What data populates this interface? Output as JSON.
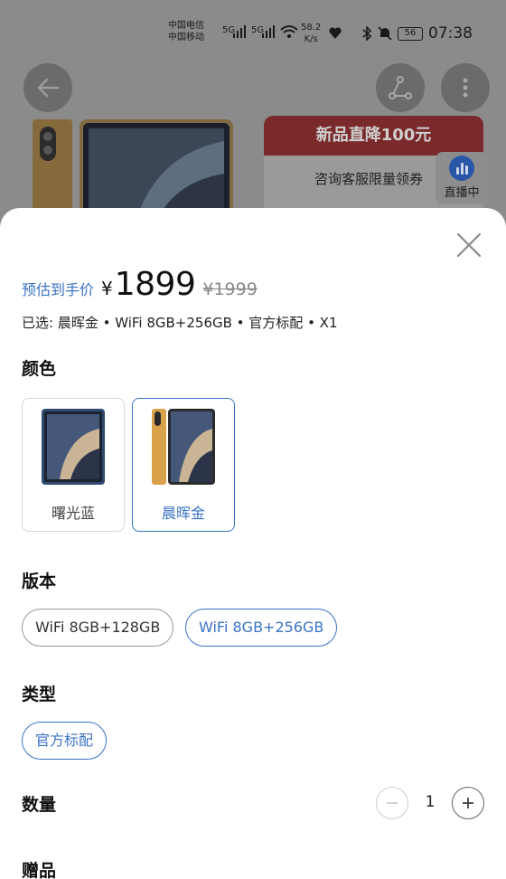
{
  "status_bar": {
    "carrier1": "中国电信",
    "carrier2": "中国移动",
    "net1": "5G",
    "net2": "5G",
    "speed_value": "58.2",
    "speed_unit": "K/s",
    "battery": "56",
    "time": "07:38"
  },
  "background": {
    "promo_banner": "新品直降100元",
    "promo_sub": "咨询客服限量领券",
    "live_label": "直播中"
  },
  "sheet": {
    "price_label": "预估到手价",
    "currency": "¥",
    "price": "1899",
    "original_price": "¥1999",
    "selected_summary": "已选: 晨晖金 • WiFi 8GB+256GB • 官方标配 • X1",
    "color_title": "颜色",
    "colors": [
      {
        "name": "曙光蓝",
        "selected": false,
        "body_color": "#2f4a6e"
      },
      {
        "name": "晨晖金",
        "selected": true,
        "body_color": "#d9a24a"
      }
    ],
    "version_title": "版本",
    "versions": [
      {
        "label": "WiFi 8GB+128GB",
        "selected": false
      },
      {
        "label": "WiFi 8GB+256GB",
        "selected": true
      }
    ],
    "type_title": "类型",
    "types": [
      {
        "label": "官方标配",
        "selected": true
      }
    ],
    "quantity_title": "数量",
    "quantity": "1",
    "gift_title": "赠品"
  },
  "colors": {
    "accent": "#3a73c4",
    "promo_red": "#7a2a2a"
  }
}
